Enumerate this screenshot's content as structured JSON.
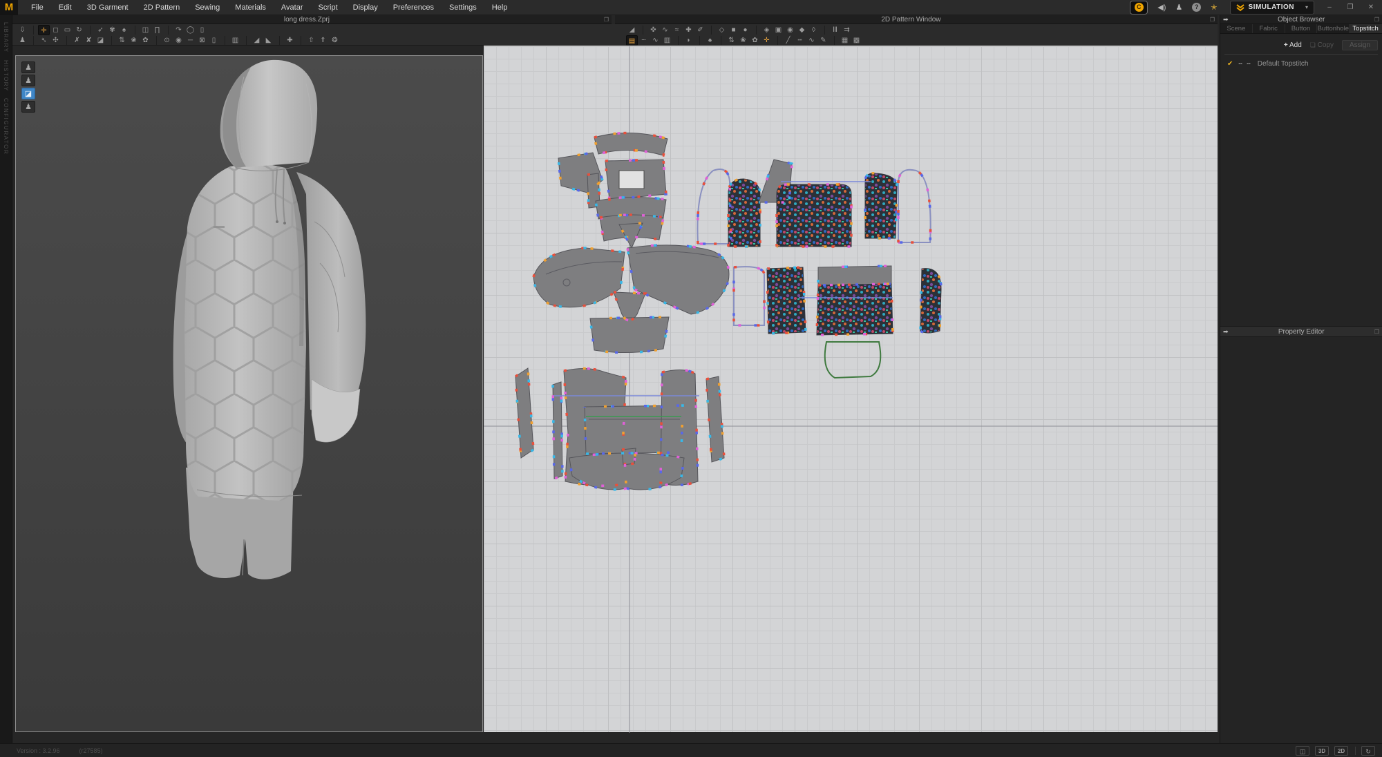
{
  "menu": {
    "logo": "M",
    "items": [
      "File",
      "Edit",
      "3D Garment",
      "2D Pattern",
      "Sewing",
      "Materials",
      "Avatar",
      "Script",
      "Display",
      "Preferences",
      "Settings",
      "Help"
    ]
  },
  "topbar": {
    "simulation_label": "SIMULATION",
    "coin_label": "C"
  },
  "glyphs": {
    "popout": "❐",
    "panel_arrow": "➡",
    "check": "✔",
    "dash_preview": "╍ ╍",
    "plus": "+",
    "copy_icon": "❏",
    "minimize": "–",
    "restore": "❐",
    "close": "✕",
    "caret": "▾"
  },
  "windows": {
    "win3d": {
      "title": "long dress.Zprj"
    },
    "win2d": {
      "title": "2D Pattern Window"
    }
  },
  "sidebar": {
    "tabs": [
      "LIBRARY",
      "HISTORY",
      "CONFIGURATOR"
    ]
  },
  "object_browser": {
    "title": "Object Browser",
    "tabs": [
      {
        "label": "Scene",
        "active": false
      },
      {
        "label": "Fabric",
        "active": false
      },
      {
        "label": "Button",
        "active": false
      },
      {
        "label": "Buttonhole",
        "active": false
      },
      {
        "label": "Topstitch",
        "active": true
      }
    ],
    "buttons": {
      "add": "Add",
      "copy": "Copy",
      "assign": "Assign"
    },
    "items": [
      {
        "name": "Default Topstitch",
        "checked": true
      }
    ]
  },
  "property_editor": {
    "title": "Property Editor"
  },
  "statusbar": {
    "version": "Version : 3.2.96",
    "revision": "(r27585)"
  },
  "colors": {
    "accent": "#f0a500",
    "selected_blue": "#3f86c6",
    "canvas": "#d3d4d6"
  },
  "toolbars": {
    "tb3a": [
      {
        "n": "gizmo-orientation",
        "g": "⇩"
      },
      {
        "t": "s"
      },
      {
        "n": "select-move",
        "g": "✛",
        "sel": true
      },
      {
        "n": "select-rectangle",
        "g": "◻"
      },
      {
        "n": "select-box",
        "g": "▭"
      },
      {
        "n": "rotate-view",
        "g": "↻"
      },
      {
        "t": "s"
      },
      {
        "n": "pin-drag",
        "g": "➶"
      },
      {
        "n": "brush-select",
        "g": "✾"
      },
      {
        "n": "tack-garment",
        "g": "♠"
      },
      {
        "t": "s"
      },
      {
        "n": "arrange-clothes",
        "g": "◫"
      },
      {
        "n": "arrange-pants",
        "g": "∏"
      },
      {
        "t": "s"
      },
      {
        "n": "curve-tool",
        "g": "↷"
      },
      {
        "n": "lasso-select",
        "g": "◯"
      },
      {
        "n": "measure-ruler",
        "g": "▯"
      }
    ],
    "tb3b": [
      {
        "n": "avatar-walk",
        "g": "♟"
      },
      {
        "t": "s"
      },
      {
        "n": "sew-pin",
        "g": "➴"
      },
      {
        "n": "pin-tack",
        "g": "✣"
      },
      {
        "t": "s"
      },
      {
        "n": "tack-on-avatar",
        "g": "✗"
      },
      {
        "n": "untack",
        "g": "✘"
      },
      {
        "n": "fold-arrangement",
        "g": "◪"
      },
      {
        "t": "s"
      },
      {
        "n": "zipper",
        "g": "⇅"
      },
      {
        "n": "gather-cursor",
        "g": "❀"
      },
      {
        "n": "gather",
        "g": "✿"
      },
      {
        "t": "s"
      },
      {
        "n": "button-place",
        "g": "⊙"
      },
      {
        "n": "button",
        "g": "◉"
      },
      {
        "n": "button-line",
        "g": "─"
      },
      {
        "n": "padlock-zip",
        "g": "⊠"
      },
      {
        "n": "zip-puller",
        "g": "▯"
      },
      {
        "t": "s"
      },
      {
        "n": "buttoned-panel",
        "g": "▥"
      },
      {
        "t": "s"
      },
      {
        "n": "wedge-cursor",
        "g": "◢"
      },
      {
        "n": "wedge",
        "g": "◣"
      },
      {
        "t": "s"
      },
      {
        "n": "measure-tape",
        "g": "✚"
      },
      {
        "t": "s"
      },
      {
        "n": "lift-garment-cursor",
        "g": "⇧"
      },
      {
        "n": "lift-garment",
        "g": "⇑"
      },
      {
        "n": "wrap-globe",
        "g": "❂"
      }
    ],
    "tb2a": [
      {
        "n": "transform-pattern",
        "g": "◢"
      },
      {
        "t": "s"
      },
      {
        "n": "edit-pattern",
        "g": "✜"
      },
      {
        "n": "edit-curvature",
        "g": "∿"
      },
      {
        "n": "edit-curve-point",
        "g": "≈"
      },
      {
        "n": "add-point",
        "g": "✚"
      },
      {
        "n": "trace",
        "g": "✐"
      },
      {
        "t": "s"
      },
      {
        "n": "polygon",
        "g": "◇"
      },
      {
        "n": "rectangle",
        "g": "■"
      },
      {
        "n": "circle",
        "g": "●"
      },
      {
        "t": "s"
      },
      {
        "n": "internal-polygon",
        "g": "◈"
      },
      {
        "n": "internal-rectangle",
        "g": "▣"
      },
      {
        "n": "internal-circle",
        "g": "◉"
      },
      {
        "n": "dart",
        "g": "◆"
      },
      {
        "n": "base-dart",
        "g": "◊"
      },
      {
        "t": "s"
      },
      {
        "n": "pleats",
        "g": "Ⅲ"
      },
      {
        "n": "pleats-fold",
        "g": "⇉"
      }
    ],
    "tb2b": [
      {
        "n": "segment-sewing",
        "g": "▤",
        "sel": true
      },
      {
        "n": "free-sewing",
        "g": "┄"
      },
      {
        "n": "mn-sewing",
        "g": "∿"
      },
      {
        "n": "detail-sewing",
        "g": "▥"
      },
      {
        "t": "s"
      },
      {
        "n": "steam-iron",
        "g": "◗"
      },
      {
        "t": "s"
      },
      {
        "n": "attach-to-garment",
        "g": "♠"
      },
      {
        "t": "s"
      },
      {
        "n": "zipper-2d",
        "g": "⇅"
      },
      {
        "n": "shirring-cursor",
        "g": "❀"
      },
      {
        "n": "shirring",
        "g": "✿"
      },
      {
        "n": "show-sewing",
        "g": "✛",
        "org": true
      },
      {
        "t": "s"
      },
      {
        "n": "topstitch-segment",
        "g": "╱"
      },
      {
        "n": "topstitch-free",
        "g": "┉"
      },
      {
        "n": "topstitch-wave",
        "g": "∿"
      },
      {
        "n": "topstitch-angle",
        "g": "✎"
      },
      {
        "t": "s"
      },
      {
        "n": "texture-edit",
        "g": "▦"
      },
      {
        "n": "texture-transform",
        "g": "▩"
      }
    ],
    "vp_toggles": [
      {
        "n": "show-avatar",
        "g": "♟"
      },
      {
        "n": "show-avatar-skin",
        "g": "♟"
      },
      {
        "n": "show-garment-fit",
        "g": "◪",
        "blue": true
      },
      {
        "n": "show-avatar-solid",
        "g": "♟"
      }
    ],
    "sb_icons": [
      {
        "n": "split-view",
        "g": "◫"
      },
      {
        "n": "view-3d",
        "g": "3D",
        "box": true
      },
      {
        "n": "view-2d",
        "g": "2D",
        "box": true
      },
      {
        "t": "s"
      },
      {
        "n": "sync-refresh",
        "g": "↻"
      }
    ]
  }
}
